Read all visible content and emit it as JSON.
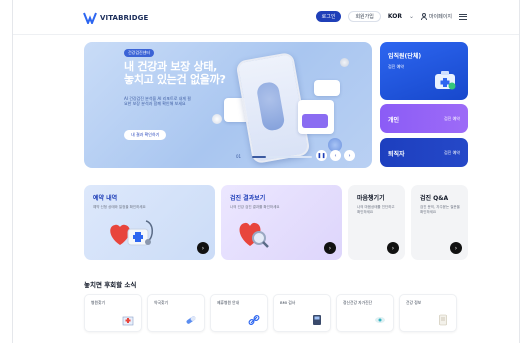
{
  "brand": {
    "name": "VITABRIDGE"
  },
  "topbar": {
    "login": "로그인",
    "signup": "회원가입",
    "language": "KOR",
    "user": "마이페이지"
  },
  "hero": {
    "tag": "건강검진센터",
    "title_line1": "내 건강과 보장 상태,",
    "title_line2": "놓치고 있는건 없을까?",
    "description": "AI 건강검진 분석을 AI 리포트로 내게 필요한 보장 분석과 함께 확인해 보세요",
    "cta": "내 결과 확인하기",
    "pager_current": "01",
    "pager_total": "03"
  },
  "side_boxes": [
    {
      "title": "임직원(단체)",
      "sub": "검진 예약"
    },
    {
      "title": "개인",
      "sub": "검진 예약"
    },
    {
      "title": "퇴직자",
      "sub": "검진 예약"
    }
  ],
  "cards": [
    {
      "title": "예약 내역",
      "desc": "예약 신청 상태와 일정을 확인하세요"
    },
    {
      "title": "검진 결과보기",
      "desc": "나의 건강 검진 결과를 확인하세요"
    },
    {
      "title": "마음챙기기",
      "desc": "나의 마음상태를 진단하고 확인하세요"
    },
    {
      "title": "검진 Q&A",
      "desc": "검진 문의, 자주묻는 질문을 확인하세요"
    }
  ],
  "section": {
    "title": "놓치면 후회할 소식"
  },
  "tiles": [
    {
      "label": "병원찾기"
    },
    {
      "label": "약국찾기"
    },
    {
      "label": "제휴병원 안내"
    },
    {
      "label": "BMI 검사"
    },
    {
      "label": "정신건강 자가진단"
    },
    {
      "label": "건강 정보"
    }
  ],
  "colors": {
    "primary": "#1f3fb8",
    "violet": "#8b5cf6",
    "hero_bg": "#b9d0f3"
  }
}
